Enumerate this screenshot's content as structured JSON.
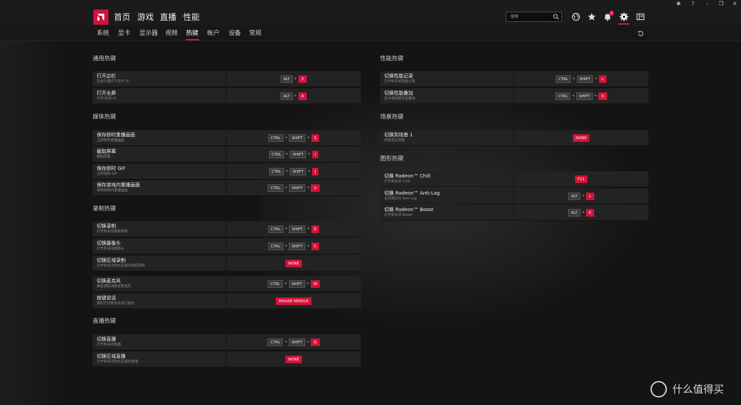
{
  "nav": {
    "items": [
      "首页",
      "游戏",
      "直播",
      "性能"
    ],
    "search_placeholder": "搜索",
    "notification_count": "1"
  },
  "subnav": {
    "items": [
      "系统",
      "显卡",
      "显示器",
      "视频",
      "热键",
      "帐户",
      "设备",
      "常规"
    ],
    "active": "热键"
  },
  "colors": {
    "accent": "#d4133a",
    "background": "#141414",
    "row": "#232323"
  },
  "left_sections": [
    {
      "title": "通用热键",
      "rows": [
        {
          "name": "打开边栏",
          "desc": "在运行模式下打开 UI",
          "keys": [
            "ALT",
            "Z"
          ]
        },
        {
          "name": "打开全屏",
          "desc": "打开/关闭 UI",
          "keys": [
            "ALT",
            "R"
          ]
        }
      ]
    },
    {
      "title": "媒体热键",
      "rows": [
        {
          "name": "保存即时重播画面",
          "desc": "立即保存重播画面",
          "keys": [
            "CTRL",
            "SHIFT",
            "S"
          ]
        },
        {
          "name": "截取屏幕",
          "desc": "截取屏幕",
          "keys": [
            "CTRL",
            "SHIFT",
            "I"
          ]
        },
        {
          "name": "保存即时 GIF",
          "desc": "立即保存 GIF",
          "keys": [
            "CTRL",
            "SHIFT",
            "J"
          ]
        },
        {
          "name": "保存游戏内重播画面",
          "desc": "保存游戏内重播画面",
          "keys": [
            "CTRL",
            "SHIFT",
            "U"
          ]
        }
      ]
    },
    {
      "title": "录制热键",
      "rows": [
        {
          "name": "切换录制",
          "desc": "打开和关闭视频录制",
          "keys": [
            "CTRL",
            "SHIFT",
            "E"
          ]
        },
        {
          "name": "切换摄像头",
          "desc": "打开和关闭摄像头",
          "keys": [
            "CTRL",
            "SHIFT",
            "C"
          ]
        },
        {
          "name": "切换区域录制",
          "desc": "打开和关闭特定区域的视频录制",
          "keys": [
            "NONE"
          ]
        },
        {
          "name": "切换麦克风",
          "desc": "静音或取消静音麦克风",
          "keys": [
            "CTRL",
            "SHIFT",
            "M"
          ]
        },
        {
          "name": "按键说话",
          "desc": "按时打开麦克风进行聊天",
          "keys": [
            "MOUSE MIDDLE"
          ]
        }
      ]
    },
    {
      "title": "直播热键",
      "rows": [
        {
          "name": "切换直播",
          "desc": "打开和关闭直播",
          "keys": [
            "CTRL",
            "SHIFT",
            "G"
          ]
        },
        {
          "name": "切换区域直播",
          "desc": "打开和关闭特定区域的直播",
          "keys": [
            "NONE"
          ]
        }
      ]
    }
  ],
  "right_sections": [
    {
      "title": "性能热键",
      "rows": [
        {
          "name": "切换性能记录",
          "desc": "打开和关闭性能记录",
          "keys": [
            "CTRL",
            "SHIFT",
            "L"
          ]
        },
        {
          "name": "切换性能叠加",
          "desc": "显示或隐藏性能叠加",
          "keys": [
            "CTRL",
            "SHIFT",
            "O"
          ]
        }
      ]
    },
    {
      "title": "场景热键",
      "rows": [
        {
          "name": "切换到场景 1",
          "desc": "转换至此场景",
          "keys": [
            "NONE"
          ]
        }
      ]
    },
    {
      "title": "图形热键",
      "rows": [
        {
          "name": "切换 Radeon™ Chill",
          "desc": "打开和关闭 Chill",
          "keys": [
            "F11"
          ]
        },
        {
          "name": "切换 Radeon™ Anti-Lag",
          "desc": "关闭和打开 Anti-Lag",
          "keys": [
            "ALT",
            "L"
          ]
        },
        {
          "name": "切换 Radeon™ Boost",
          "desc": "打开和关闭 Boost",
          "keys": [
            "ALT",
            "K"
          ]
        }
      ]
    }
  ],
  "watermark": "什么值得买"
}
